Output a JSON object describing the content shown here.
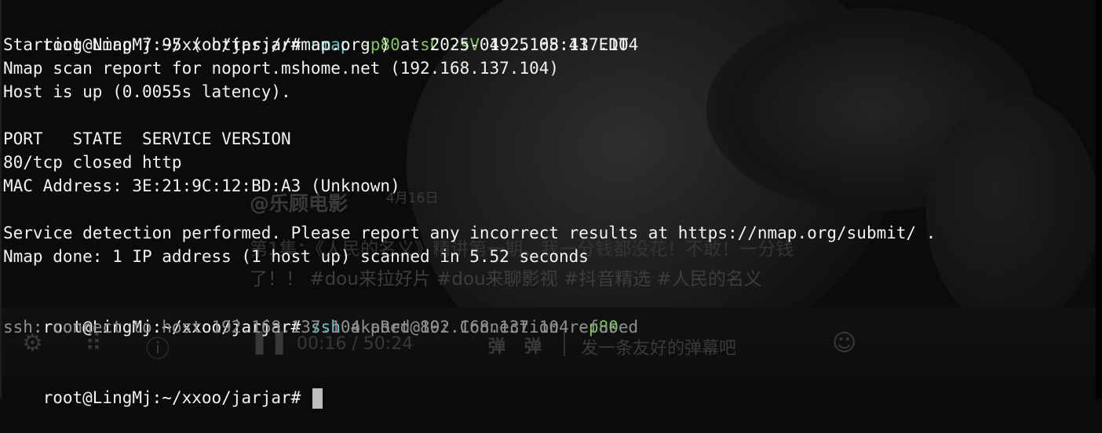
{
  "terminal": {
    "prompt": "root@LingMj:~/xxoo/jarjar#",
    "cmd1": {
      "program": "nmap",
      "flag1": "-p80",
      "flag2": "-sC",
      "flag3": "-sV",
      "target": "192.168.137.104"
    },
    "output1": [
      "Starting Nmap 7.95 ( https://nmap.org ) at 2025-04-25 05:41 EDT",
      "Nmap scan report for noport.mshome.net (192.168.137.104)",
      "Host is up (0.0055s latency).",
      "",
      "PORT   STATE  SERVICE VERSION",
      "80/tcp closed http",
      "MAC Address: 3E:21:9C:12:BD:A3 (Unknown)",
      "",
      "Service detection performed. Please report any incorrect results at https://nmap.org/submit/ .",
      "Nmap done: 1 IP address (1 host up) scanned in 5.52 seconds",
      ""
    ],
    "cmd2": {
      "program": "ssh",
      "args": "akaRed@192.168.137.104",
      "flag": "-p80"
    },
    "output2": "ssh: connect to host 192.168.137.104 port 80: Connection refused"
  },
  "overlay": {
    "account": "@乐顾电影",
    "date": "4月16日",
    "desc_line1": "第1集：《人民的名义》精讲第一期。我一分钱都没花！不敢！一分钱",
    "desc_line2": "了！！ #dou来拉好片 #dou来聊影视 #抖音精选 #人民的名义",
    "time": "00:16 / 50:24",
    "danmu_label_a": "弹",
    "danmu_label_b": "弹",
    "danmu_placeholder": "发一条友好的弹幕吧",
    "icons": {
      "settings": "settings-icon",
      "grid": "grid-icon",
      "help": "help-icon",
      "pause": "pause-icon",
      "emoji": "emoji-icon"
    }
  }
}
